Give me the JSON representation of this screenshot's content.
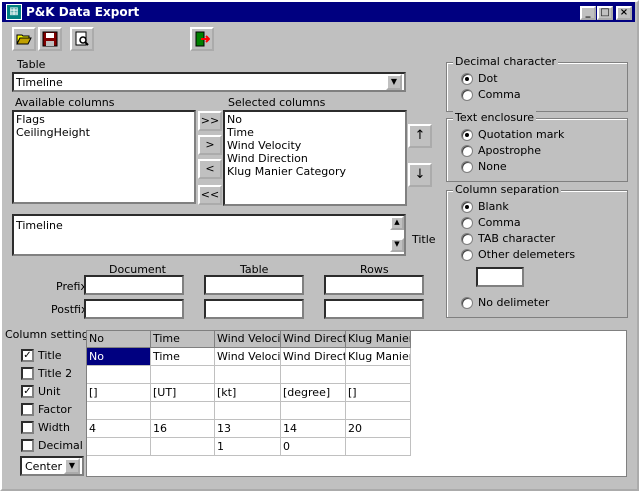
{
  "window": {
    "title": "P&K Data Export"
  },
  "toolbar": {
    "open_icon": "folder-open-icon",
    "save_icon": "floppy-save-icon",
    "preview_icon": "print-preview-icon",
    "exit_icon": "exit-door-icon"
  },
  "table": {
    "label": "Table",
    "value": "Timeline"
  },
  "available": {
    "label": "Available columns",
    "items": [
      "Flags",
      "CeilingHeight"
    ]
  },
  "selected": {
    "label": "Selected columns",
    "items": [
      "No",
      "Time",
      "Wind Velocity",
      "Wind Direction",
      "Klug Manier Category"
    ]
  },
  "move": {
    "add_all": ">>",
    "add": ">",
    "remove": "<",
    "remove_all": "<<"
  },
  "order": {
    "up": "↑",
    "down": "↓"
  },
  "title_field": {
    "value": "Timeline",
    "label": "Title"
  },
  "headfoot": {
    "document": "Document",
    "table": "Table",
    "rows": "Rows",
    "prefix": "Prefix",
    "postfix": "Postfix"
  },
  "decimal": {
    "title": "Decimal character",
    "options": [
      "Dot",
      "Comma"
    ],
    "selected": 0
  },
  "enclosure": {
    "title": "Text enclosure",
    "options": [
      "Quotation mark",
      "Apostrophe",
      "None"
    ],
    "selected": 0
  },
  "separation": {
    "title": "Column separation",
    "options": [
      "Blank",
      "Comma",
      "TAB character",
      "Other delemeters"
    ],
    "no_delim": "No delimeter",
    "selected": 0
  },
  "colsettings": {
    "title": "Column settings",
    "items": [
      {
        "label": "Title",
        "checked": true
      },
      {
        "label": "Title 2",
        "checked": false
      },
      {
        "label": "Unit",
        "checked": true
      },
      {
        "label": "Factor",
        "checked": false
      },
      {
        "label": "Width",
        "checked": false
      },
      {
        "label": "Decimal",
        "checked": false
      }
    ],
    "align": "Center"
  },
  "grid": {
    "headers": [
      "No",
      "Time",
      "Wind Velocity",
      "Wind Direction",
      "Klug Manier Category"
    ],
    "rows": [
      [
        "No",
        "Time",
        "Wind Velocity",
        "Wind Direction",
        "Klug Manier Category"
      ],
      [
        "",
        "",
        "",
        "",
        ""
      ],
      [
        "[]",
        "[UT]",
        "[kt]",
        "[degree]",
        "[]"
      ],
      [
        "",
        "",
        "",
        "",
        ""
      ],
      [
        "4",
        "16",
        "13",
        "14",
        "20"
      ],
      [
        "",
        "",
        "1",
        "0",
        ""
      ]
    ]
  }
}
